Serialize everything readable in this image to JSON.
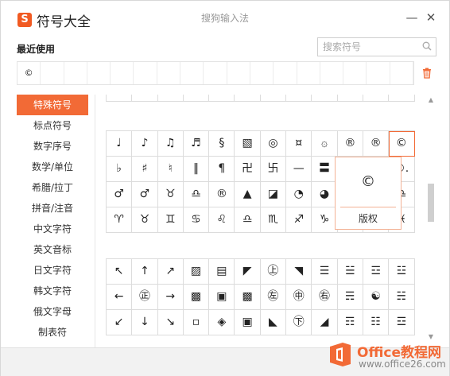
{
  "app": {
    "logo_char": "S",
    "title": "符号大全",
    "window_title": "搜狗输入法",
    "minimize_label": "—",
    "close_label": "✕"
  },
  "recent": {
    "title": "最近使用",
    "items": [
      "©",
      "",
      "",
      "",
      "",
      "",
      "",
      "",
      "",
      "",
      "",
      "",
      "",
      "",
      "",
      "",
      ""
    ]
  },
  "search": {
    "placeholder": "搜索符号",
    "value": ""
  },
  "sidebar": {
    "items": [
      {
        "label": "特殊符号",
        "active": true
      },
      {
        "label": "标点符号"
      },
      {
        "label": "数字序号"
      },
      {
        "label": "数学/单位"
      },
      {
        "label": "希腊/拉丁"
      },
      {
        "label": "拼音/注音"
      },
      {
        "label": "中文字符"
      },
      {
        "label": "英文音标"
      },
      {
        "label": "日文字符"
      },
      {
        "label": "韩文字符"
      },
      {
        "label": "俄文字母"
      },
      {
        "label": "制表符"
      }
    ]
  },
  "grid1": {
    "rows": [
      [
        "♩",
        "♪",
        "♫",
        "♬",
        "§",
        "▧",
        "◎",
        "¤",
        "۞",
        "®",
        "®",
        "©"
      ],
      [
        "♭",
        "♯",
        "♮",
        "‖",
        "¶",
        "卍",
        "卐",
        "—",
        "〓",
        "",
        "",
        "©."
      ],
      [
        "♂",
        "♂",
        "♉",
        "♎",
        "®",
        "▲",
        "◪",
        "◔",
        "◕",
        "",
        "",
        "♎"
      ],
      [
        "♈",
        "♉",
        "♊",
        "♋",
        "♌",
        "♎",
        "♏",
        "♐",
        "♑",
        "",
        "",
        "♓"
      ]
    ]
  },
  "grid2": {
    "rows": [
      [
        "↖",
        "↑",
        "↗",
        "▨",
        "▤",
        "◤",
        "㊤",
        "◥",
        "☰",
        "☱",
        "☲",
        "☳"
      ],
      [
        "←",
        "㊣",
        "→",
        "▩",
        "▣",
        "▩",
        "㊧",
        "㊥",
        "㊨",
        "☴",
        "☯",
        "☵"
      ],
      [
        "↙",
        "↓",
        "↘",
        "▫",
        "◈",
        "▣",
        "◣",
        "㊦",
        "◢",
        "☶",
        "☷",
        "☲"
      ]
    ]
  },
  "preview": {
    "symbol": "©",
    "label": "版权"
  },
  "watermark": {
    "line1": "Office教程网",
    "line2": "www.office26.com"
  },
  "colors": {
    "accent": "#f26a36",
    "logo": "#f15a22"
  }
}
